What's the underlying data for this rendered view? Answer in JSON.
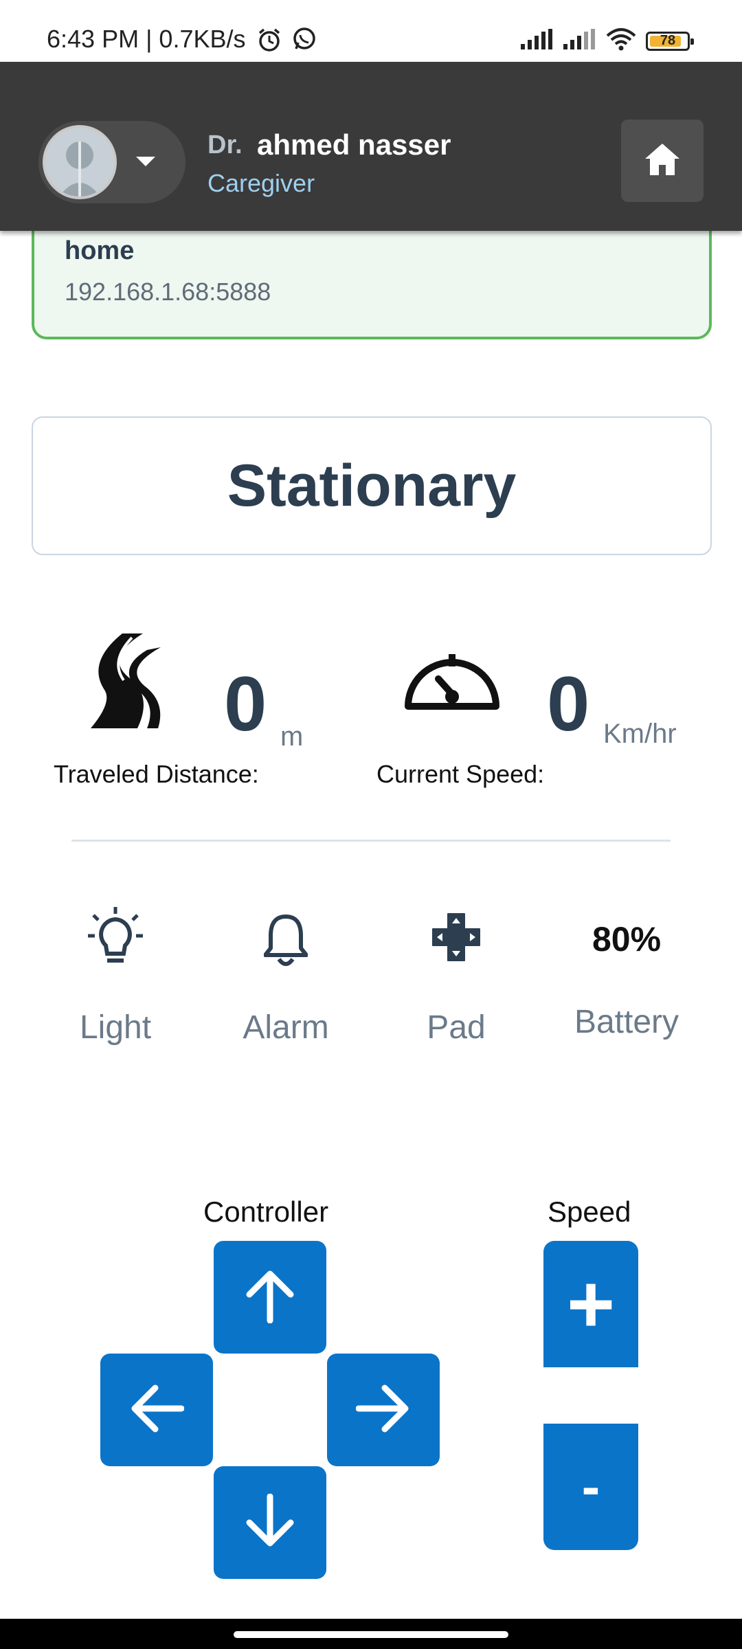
{
  "status_bar": {
    "time_and_speed": "6:43 PM | 0.7KB/s",
    "battery_level": "78"
  },
  "header": {
    "title_prefix": "Dr.",
    "user_name": "ahmed nasser",
    "role": "Caregiver"
  },
  "connection": {
    "name": "home",
    "address": "192.168.1.68:5888"
  },
  "status": {
    "state": "Stationary"
  },
  "stats": {
    "distance_value": "0",
    "distance_unit": "m",
    "distance_label": "Traveled Distance:",
    "speed_value": "0",
    "speed_unit": "Km/hr",
    "speed_label": "Current Speed:"
  },
  "features": {
    "light_label": "Light",
    "alarm_label": "Alarm",
    "pad_label": "Pad",
    "battery_label": "Battery",
    "battery_value": "80%"
  },
  "controller": {
    "title": "Controller",
    "speed_title": "Speed",
    "speed_up_label": "+",
    "speed_down_label": "-"
  },
  "colors": {
    "header_bg": "#3a3a3a",
    "accent_blue": "#0a74c9",
    "connected_green": "#5cb85c",
    "text_dark": "#2c3e50"
  },
  "icons": {
    "distance": "road-icon",
    "speed": "speedometer-icon",
    "light": "lightbulb-icon",
    "alarm": "bell-icon",
    "pad": "dpad-icon",
    "home": "home-icon"
  }
}
